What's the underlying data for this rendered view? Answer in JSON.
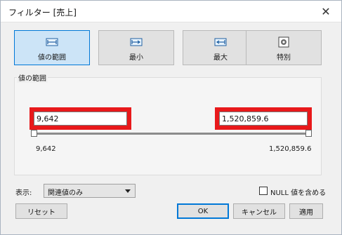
{
  "window": {
    "title": "フィルター [売上]"
  },
  "tabs": [
    {
      "label": "値の範囲",
      "icon": "range-icon",
      "active": true
    },
    {
      "label": "最小",
      "icon": "min-icon",
      "active": false
    },
    {
      "label": "最大",
      "icon": "max-icon",
      "active": false
    },
    {
      "label": "特別",
      "icon": "special-icon",
      "active": false
    }
  ],
  "range_section": {
    "title": "値の範囲",
    "min_value": "9,642",
    "max_value": "1,520,859.6",
    "min_label": "9,642",
    "max_label": "1,520,859.6"
  },
  "display": {
    "label": "表示:",
    "selected": "関連値のみ"
  },
  "null_option": {
    "label": "NULL 値を含める",
    "checked": false
  },
  "buttons": {
    "reset": "リセット",
    "ok": "OK",
    "cancel": "キャンセル",
    "apply": "適用"
  },
  "colors": {
    "highlight": "#e8191b",
    "active_tab": "#cce4f7",
    "accent": "#0078d7"
  }
}
